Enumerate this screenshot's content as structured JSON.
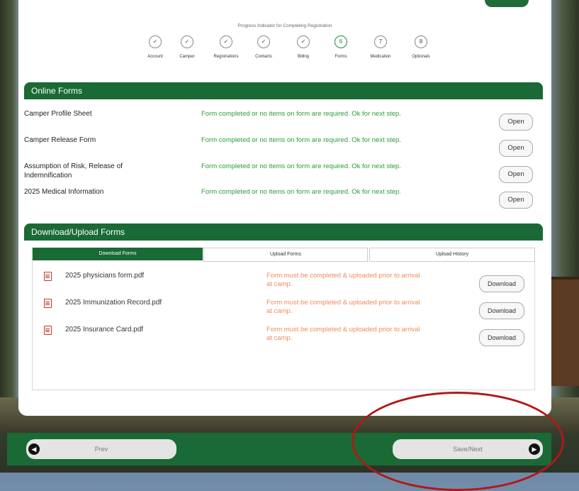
{
  "progress": {
    "title": "Progress Indicator for Completing Registration",
    "steps": [
      {
        "icon": "✓",
        "label": "Account"
      },
      {
        "icon": "✓",
        "label": "Camper"
      },
      {
        "icon": "✓",
        "label": "Registrations"
      },
      {
        "icon": "✓",
        "label": "Contacts"
      },
      {
        "icon": "✓",
        "label": "Billing"
      },
      {
        "icon": "6",
        "label": "Forms"
      },
      {
        "icon": "7",
        "label": "Medication"
      },
      {
        "icon": "8",
        "label": "Optionals"
      }
    ]
  },
  "online_forms": {
    "title": "Online Forms",
    "open_label": "Open",
    "rows": [
      {
        "name": "Camper Profile Sheet",
        "status": "Form completed or no items on form are required. Ok for next step."
      },
      {
        "name": "Camper Release Form",
        "status": "Form completed or no items on form are required. Ok for next step."
      },
      {
        "name": "Assumption of Risk, Release of Indemnification",
        "status": "Form completed or no items on form are required. Ok for next step."
      },
      {
        "name": "2025 Medical Information",
        "status": "Form completed or no items on form are required. Ok for next step."
      }
    ]
  },
  "download_upload": {
    "title": "Download/Upload Forms",
    "tabs": [
      "Download Forms",
      "Upload Forms",
      "Upload History"
    ],
    "download_label": "Download",
    "rows": [
      {
        "name": "2025 physicians form.pdf",
        "status": "Form must be completed & uploaded prior to arrival at camp."
      },
      {
        "name": "2025 Immunization Record.pdf",
        "status": "Form must be completed & uploaded prior to arrival at camp."
      },
      {
        "name": "2025 Insurance Card.pdf",
        "status": "Form must be completed & uploaded prior to arrival at camp."
      }
    ]
  },
  "footer": {
    "prev_label": "Prev",
    "next_label": "Save/Next",
    "prev_icon": "arrow-left-circle",
    "next_icon": "arrow-right-circle"
  },
  "colors": {
    "brand_green": "#1a6a35",
    "status_ok": "#2c9a3c",
    "status_warn": "#f28a5a",
    "annotation": "#b01818"
  }
}
